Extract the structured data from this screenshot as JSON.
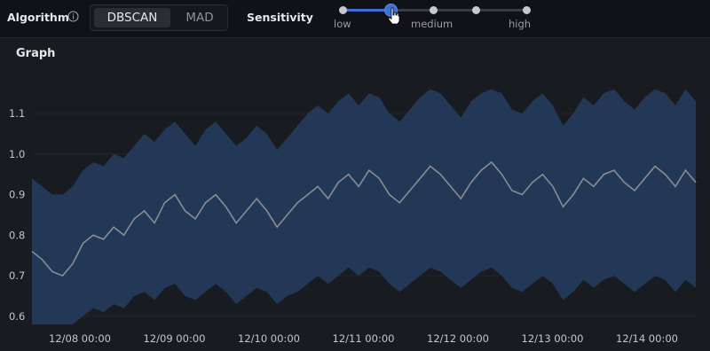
{
  "toolbar": {
    "algorithm_label": "Algorithm",
    "algorithm_options": [
      "DBSCAN",
      "MAD"
    ],
    "algorithm_selected": "DBSCAN",
    "sensitivity_label": "Sensitivity",
    "sensitivity_ticks": [
      "low",
      "medium",
      "high"
    ],
    "sensitivity_value": 0.25
  },
  "panel": {
    "title": "Graph"
  },
  "colors": {
    "band": "#233a5a",
    "line": "#8a8c93",
    "accent": "#3d71d9"
  },
  "chart_data": {
    "type": "area",
    "title": "Graph",
    "x_ticks": [
      "12/08 00:00",
      "12/09 00:00",
      "12/10 00:00",
      "12/11 00:00",
      "12/12 00:00",
      "12/13 00:00",
      "12/14 00:00"
    ],
    "y_ticks": [
      "0.6",
      "0.7",
      "0.8",
      "0.9",
      "1.0",
      "1.1"
    ],
    "ylim": [
      0.58,
      1.17
    ],
    "grid": true,
    "series": [
      {
        "values": [
          0.76,
          0.74,
          0.71,
          0.7,
          0.73,
          0.78,
          0.8,
          0.79,
          0.82,
          0.8,
          0.84,
          0.86,
          0.83,
          0.88,
          0.9,
          0.86,
          0.84,
          0.88,
          0.9,
          0.87,
          0.83,
          0.86,
          0.89,
          0.86,
          0.82,
          0.85,
          0.88,
          0.9,
          0.92,
          0.89,
          0.93,
          0.95,
          0.92,
          0.96,
          0.94,
          0.9,
          0.88,
          0.91,
          0.94,
          0.97,
          0.95,
          0.92,
          0.89,
          0.93,
          0.96,
          0.98,
          0.95,
          0.91,
          0.9,
          0.93,
          0.95,
          0.92,
          0.87,
          0.9,
          0.94,
          0.92,
          0.95,
          0.96,
          0.93,
          0.91,
          0.94,
          0.97,
          0.95,
          0.92,
          0.96,
          0.93
        ]
      },
      {
        "lower": [
          0.58,
          0.58,
          0.58,
          0.58,
          0.58,
          0.6,
          0.62,
          0.61,
          0.63,
          0.62,
          0.65,
          0.66,
          0.64,
          0.67,
          0.68,
          0.65,
          0.64,
          0.66,
          0.68,
          0.66,
          0.63,
          0.65,
          0.67,
          0.66,
          0.63,
          0.65,
          0.66,
          0.68,
          0.7,
          0.68,
          0.7,
          0.72,
          0.7,
          0.72,
          0.71,
          0.68,
          0.66,
          0.68,
          0.7,
          0.72,
          0.71,
          0.69,
          0.67,
          0.69,
          0.71,
          0.72,
          0.7,
          0.67,
          0.66,
          0.68,
          0.7,
          0.68,
          0.64,
          0.66,
          0.69,
          0.67,
          0.69,
          0.7,
          0.68,
          0.66,
          0.68,
          0.7,
          0.69,
          0.66,
          0.69,
          0.67
        ],
        "upper": [
          0.94,
          0.92,
          0.9,
          0.9,
          0.92,
          0.96,
          0.98,
          0.97,
          1.0,
          0.99,
          1.02,
          1.05,
          1.03,
          1.06,
          1.08,
          1.05,
          1.02,
          1.06,
          1.08,
          1.05,
          1.02,
          1.04,
          1.07,
          1.05,
          1.01,
          1.04,
          1.07,
          1.1,
          1.12,
          1.1,
          1.13,
          1.15,
          1.12,
          1.15,
          1.14,
          1.1,
          1.08,
          1.11,
          1.14,
          1.16,
          1.15,
          1.12,
          1.09,
          1.13,
          1.15,
          1.16,
          1.15,
          1.11,
          1.1,
          1.13,
          1.15,
          1.12,
          1.07,
          1.1,
          1.14,
          1.12,
          1.15,
          1.16,
          1.13,
          1.11,
          1.14,
          1.16,
          1.15,
          1.12,
          1.16,
          1.13
        ]
      }
    ]
  }
}
